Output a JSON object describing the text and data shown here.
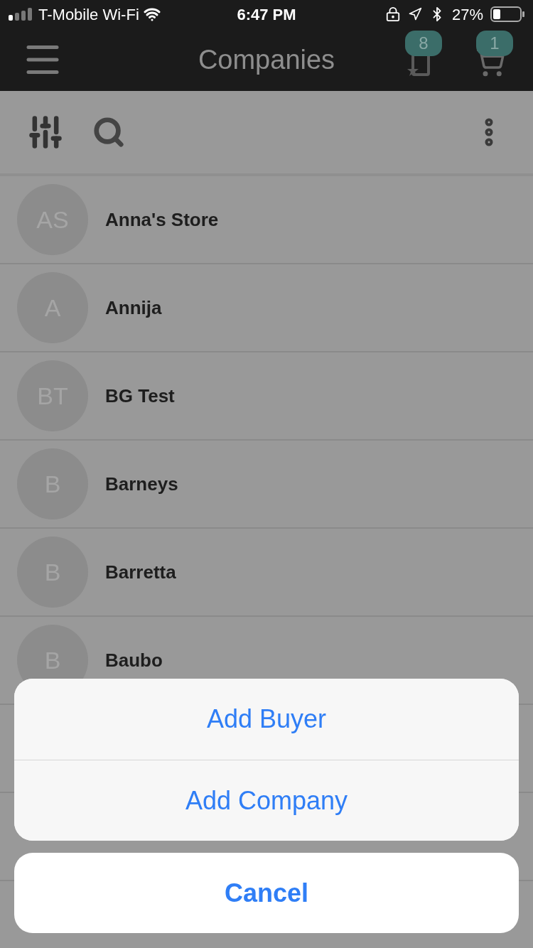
{
  "status_bar": {
    "carrier": "T-Mobile Wi-Fi",
    "time": "6:47 PM",
    "battery": "27%"
  },
  "nav_bar": {
    "title": "Companies",
    "badges": [
      "8",
      "1"
    ]
  },
  "companies": [
    {
      "initials": "AS",
      "name": "Anna's Store"
    },
    {
      "initials": "A",
      "name": "Annija"
    },
    {
      "initials": "BT",
      "name": "BG Test"
    },
    {
      "initials": "B",
      "name": "Barneys"
    },
    {
      "initials": "B",
      "name": "Barretta"
    },
    {
      "initials": "B",
      "name": "Baubo"
    }
  ],
  "action_sheet": {
    "actions": [
      "Add Buyer",
      "Add Company"
    ],
    "cancel": "Cancel"
  }
}
